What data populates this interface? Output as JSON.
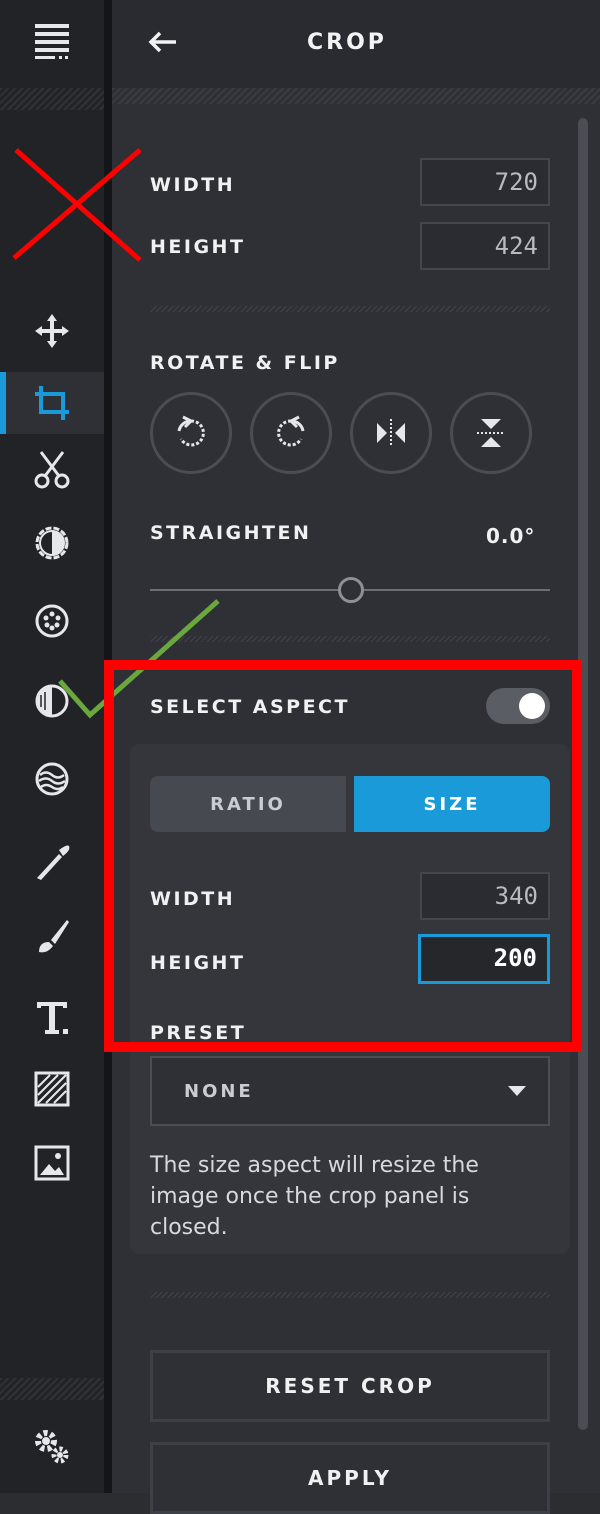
{
  "header": {
    "title": "CROP",
    "back_icon": "arrow-left-icon"
  },
  "crop_size": {
    "width_label": "WIDTH",
    "width_value": "720",
    "height_label": "HEIGHT",
    "height_value": "424"
  },
  "rotate_flip": {
    "label": "ROTATE & FLIP",
    "buttons": [
      "rotate-left-icon",
      "rotate-right-icon",
      "flip-horizontal-icon",
      "flip-vertical-icon"
    ]
  },
  "straighten": {
    "label": "STRAIGHTEN",
    "value": "0.0°",
    "level": 0.5
  },
  "select_aspect": {
    "label": "SELECT ASPECT",
    "enabled": true
  },
  "aspect_tabs": {
    "ratio": "RATIO",
    "size": "SIZE",
    "selected": "SIZE"
  },
  "aspect_size": {
    "width_label": "WIDTH",
    "width_value": "340",
    "height_label": "HEIGHT",
    "height_value": "200"
  },
  "preset": {
    "label": "PRESET",
    "value": "NONE"
  },
  "note": "The size aspect will resize the image once the crop panel is closed.",
  "buttons": {
    "reset": "RESET CROP",
    "apply": "APPLY"
  },
  "colors": {
    "accent": "#1a9ad8",
    "annotation_red": "#ff0000",
    "annotation_green": "#6aa83e"
  },
  "tools": [
    "menu-icon",
    "move-icon",
    "crop-icon",
    "cut-icon",
    "brightness-icon",
    "filter-icon",
    "vignette-icon",
    "waves-icon",
    "brush-icon",
    "paint-icon",
    "text-icon",
    "texture-icon",
    "image-icon",
    "settings-icon"
  ]
}
